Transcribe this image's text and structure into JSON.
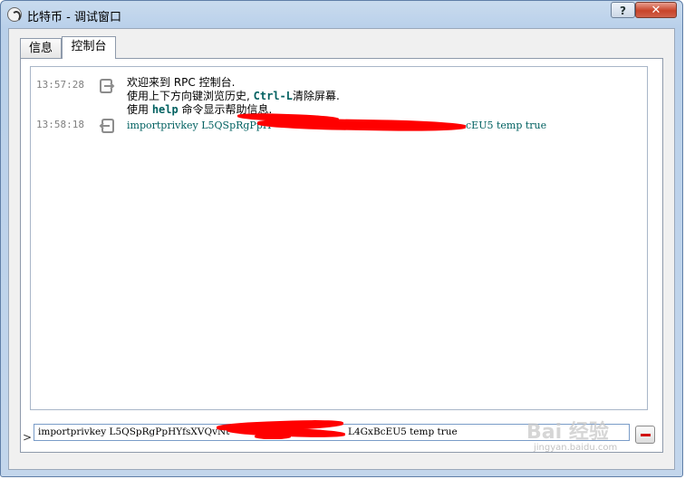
{
  "window": {
    "title": "比特币 - 调试窗口",
    "help_label": "?",
    "close_label": "✕"
  },
  "tabs": [
    {
      "label": "信息",
      "active": false
    },
    {
      "label": "控制台",
      "active": true
    }
  ],
  "console": {
    "messages": [
      {
        "timestamp": "13:57:28",
        "direction": "reply",
        "lines": {
          "l1": "欢迎来到 RPC 控制台.",
          "l2_pre": "使用上下方向键浏览历史, ",
          "l2_key": "Ctrl-L",
          "l2_post": "清除屏幕.",
          "l3_pre": "使用 ",
          "l3_key": "help",
          "l3_post": " 命令显示帮助信息."
        }
      },
      {
        "timestamp": "13:58:18",
        "direction": "request",
        "command_start": "importprivkey L5QSpRgPpH",
        "command_end": "cEU5 temp true"
      }
    ],
    "prompt": ">",
    "input_start": "importprivkey L5QSpRgPpHYfsXVQvNt",
    "input_end": "L4GxBcEU5 temp true"
  },
  "watermark": {
    "brand": "Bai 经验",
    "url": "jingyan.baidu.com"
  },
  "colors": {
    "accent_teal": "#006060",
    "redaction": "#ff0000",
    "timestamp_gray": "#808080"
  }
}
